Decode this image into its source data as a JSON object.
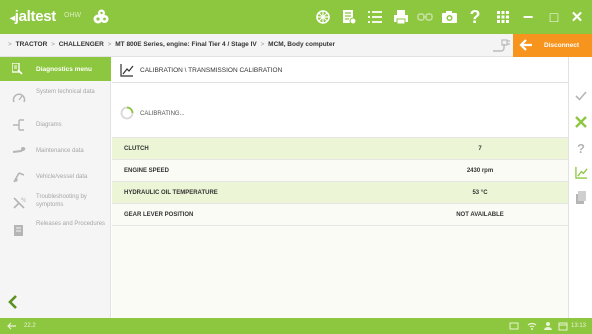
{
  "app": {
    "brand": "jaltest",
    "brand_sub": "OHW",
    "colors": {
      "primary_green": "#8dc63f",
      "accent_orange": "#f7941d",
      "row_highlight": "#ecf5d6"
    }
  },
  "toolbar": {
    "icons": [
      "network-icon",
      "report-icon",
      "list-icon",
      "print-icon",
      "link-icon",
      "camera-icon",
      "help-icon",
      "grid-icon"
    ],
    "help_label": "?",
    "window_controls": {
      "minimize": "−",
      "maximize": "□",
      "close": "✕"
    }
  },
  "breadcrumb": {
    "items": [
      "TRACTOR",
      "CHALLENGER",
      "MT 800E Series, engine: Final Tier 4 / Stage IV",
      "MCM, Body computer"
    ],
    "separator": ">"
  },
  "disconnect": {
    "label": "Disconnect"
  },
  "sidebar": {
    "active": {
      "label": "Diagnostics menu",
      "icon": "diagnostics-icon"
    },
    "items": [
      {
        "label": "System technical data",
        "icon": "gauge-icon"
      },
      {
        "label": "Diagrams",
        "icon": "diagram-icon"
      },
      {
        "label": "Maintenance data",
        "icon": "wrench-icon"
      },
      {
        "label": "Vehicle/vessel data",
        "icon": "vehicle-icon"
      },
      {
        "label": "Troubleshooting by symptoms",
        "icon": "troubleshooting-icon"
      },
      {
        "label": "Releases and Procedures",
        "icon": "procedures-icon"
      }
    ],
    "back_icon": "chevron-left-icon"
  },
  "main": {
    "title": "CALIBRATION \\ TRANSMISSION CALIBRATION",
    "status": "CALIBRATING...",
    "rows": [
      {
        "name": "CLUTCH",
        "value": "7"
      },
      {
        "name": "ENGINE SPEED",
        "value": "2430 rpm"
      },
      {
        "name": "HYDRAULIC OIL TEMPERATURE",
        "value": "53 °C"
      },
      {
        "name": "GEAR LEVER POSITION",
        "value": "NOT AVAILABLE"
      }
    ]
  },
  "rightbar": {
    "buttons": [
      {
        "name": "check-icon",
        "glyph": "✓",
        "color": "#b5b5b5"
      },
      {
        "name": "cancel-icon",
        "glyph": "✕",
        "color": "#8dc63f"
      },
      {
        "name": "help-icon",
        "glyph": "?",
        "color": "#b5b5b5"
      },
      {
        "name": "graph-icon",
        "glyph": "",
        "color": "#8dc63f"
      },
      {
        "name": "document-icon",
        "glyph": "",
        "color": "#b5b5b5"
      }
    ]
  },
  "statusbar": {
    "version": "22.2",
    "time": "13:13",
    "tray_icons": [
      "device-icon",
      "wifi-icon",
      "user-icon",
      "calendar-icon"
    ]
  }
}
